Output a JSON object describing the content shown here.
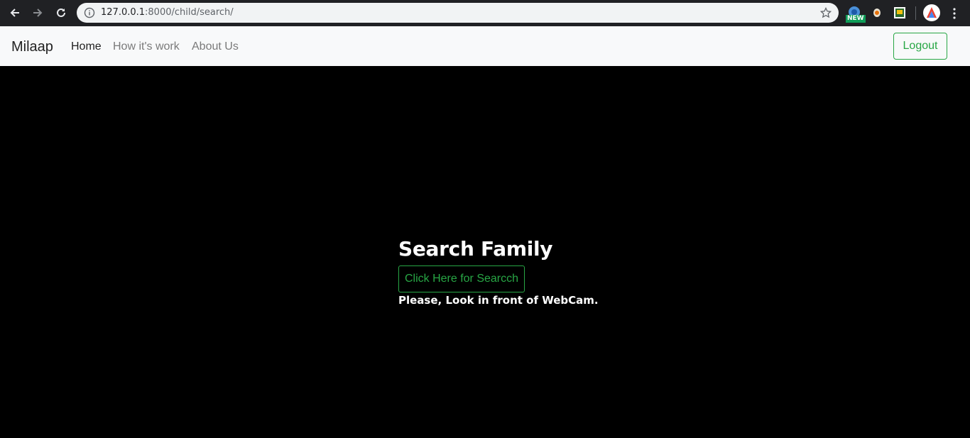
{
  "browser": {
    "url_host": "127.0.0.1",
    "url_rest": ":8000/child/search/",
    "ext_badge": "NEW"
  },
  "navbar": {
    "brand": "Milaap",
    "links": [
      {
        "label": "Home",
        "active": true
      },
      {
        "label": "How it's work",
        "active": false
      },
      {
        "label": "About Us",
        "active": false
      }
    ],
    "logout_label": "Logout"
  },
  "main": {
    "title": "Search Family",
    "search_button_label": "Click Here for Searcch",
    "hint": "Please, Look in front of WebCam."
  },
  "colors": {
    "accent": "#28a745",
    "background": "#000000",
    "navbar_bg": "#f8f9fa"
  }
}
